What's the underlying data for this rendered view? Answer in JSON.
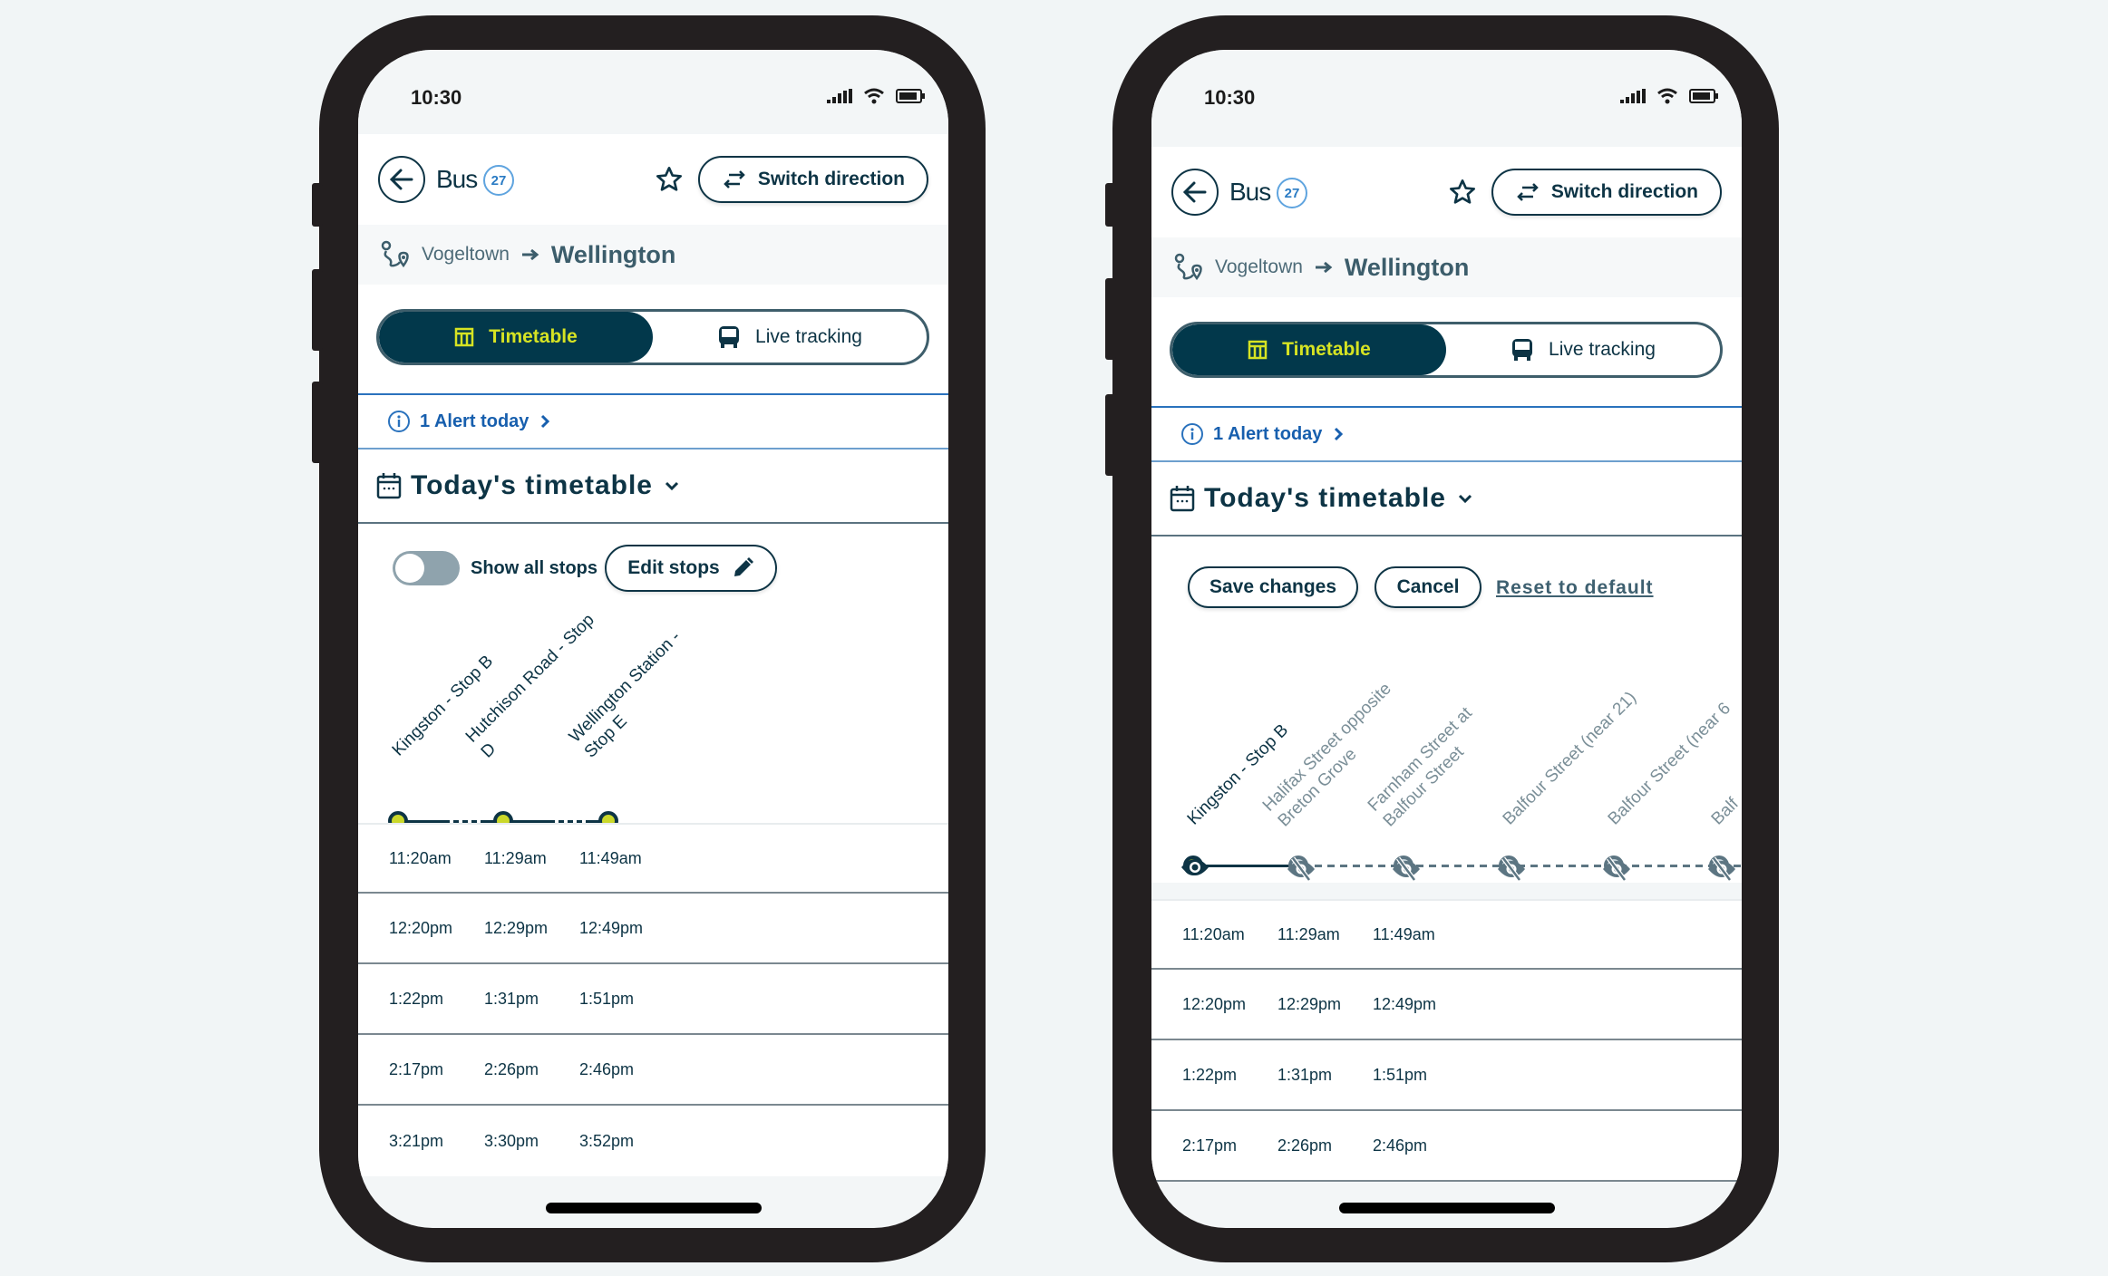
{
  "status_bar": {
    "time": "10:30",
    "icons": [
      "signal-icon",
      "wifi-icon",
      "battery-icon"
    ]
  },
  "header": {
    "back_icon": "arrow-left-icon",
    "mode_label": "Bus",
    "route_number": "27",
    "favorite_icon": "star-outline-icon",
    "switch_direction_label": "Switch direction"
  },
  "route": {
    "from": "Vogeltown",
    "to": "Wellington"
  },
  "tabs": [
    {
      "label": "Timetable",
      "icon": "timetable-icon",
      "active": true
    },
    {
      "label": "Live tracking",
      "icon": "bus-front-icon",
      "active": false
    }
  ],
  "alert": {
    "label": "1 Alert today"
  },
  "timetable_title": "Today's timetable",
  "colors": {
    "primary": "#02384b",
    "accent": "#d6e323",
    "link": "#175fae",
    "background": "#f1f5f6"
  },
  "screen_default": {
    "show_all_stops_label": "Show all stops",
    "show_all_stops_on": false,
    "edit_stops_label": "Edit stops",
    "stops": [
      {
        "name_line1": "Kingston - Stop B",
        "name_line2": ""
      },
      {
        "name_line1": "Hutchison Road - Stop",
        "name_line2": "D"
      },
      {
        "name_line1": "Wellington Station -",
        "name_line2": "Stop E"
      }
    ],
    "rows": [
      [
        "11:20am",
        "11:29am",
        "11:49am"
      ],
      [
        "12:20pm",
        "12:29pm",
        "12:49pm"
      ],
      [
        "1:22pm",
        "1:31pm",
        "1:51pm"
      ],
      [
        "2:17pm",
        "2:26pm",
        "2:46pm"
      ],
      [
        "3:21pm",
        "3:30pm",
        "3:52pm"
      ]
    ]
  },
  "screen_edit": {
    "save_label": "Save changes",
    "cancel_label": "Cancel",
    "reset_label": "Reset to default",
    "stops": [
      {
        "name_line1": "Kingston - Stop B",
        "name_line2": "",
        "visible": true
      },
      {
        "name_line1": "Halifax Street opposite",
        "name_line2": "Breton Grove",
        "visible": false
      },
      {
        "name_line1": "Farnham Street at",
        "name_line2": "Balfour Street",
        "visible": false
      },
      {
        "name_line1": "Balfour Street (near 21)",
        "name_line2": "",
        "visible": false
      },
      {
        "name_line1": "Balfour Street (near 6",
        "name_line2": "",
        "visible": false
      },
      {
        "name_line1": "Balf",
        "name_line2": "",
        "visible": false
      }
    ],
    "rows": [
      [
        "11:20am",
        "11:29am",
        "11:49am"
      ],
      [
        "12:20pm",
        "12:29pm",
        "12:49pm"
      ],
      [
        "1:22pm",
        "1:31pm",
        "1:51pm"
      ],
      [
        "2:17pm",
        "2:26pm",
        "2:46pm"
      ]
    ]
  }
}
